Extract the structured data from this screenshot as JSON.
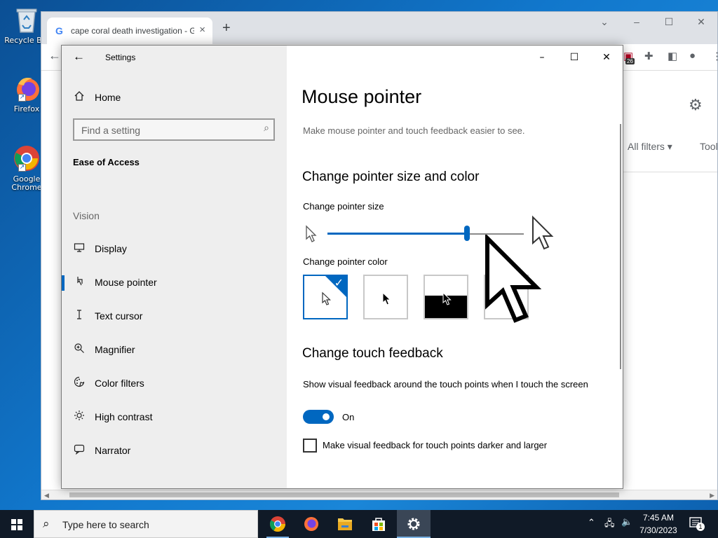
{
  "desktop": {
    "icons": [
      {
        "label": "Recycle Bin",
        "icon": "recycle-bin-icon"
      },
      {
        "label": "Firefox",
        "icon": "firefox-icon"
      },
      {
        "label": "Google Chrome",
        "icon": "chrome-icon"
      }
    ]
  },
  "browser": {
    "tab_title": "cape coral death investigation - Google Search",
    "new_tab": "+",
    "filters_label": "All filters ▾",
    "tools_label": "Tools",
    "extension_badge": "26"
  },
  "settings": {
    "app_title": "Settings",
    "sidebar": {
      "home_label": "Home",
      "search_placeholder": "Find a setting",
      "section_title": "Ease of Access",
      "group_label": "Vision",
      "items": [
        {
          "label": "Display",
          "icon": "display-icon"
        },
        {
          "label": "Mouse pointer",
          "icon": "mouse-pointer-icon",
          "selected": true
        },
        {
          "label": "Text cursor",
          "icon": "text-cursor-icon"
        },
        {
          "label": "Magnifier",
          "icon": "magnifier-icon"
        },
        {
          "label": "Color filters",
          "icon": "color-filters-icon"
        },
        {
          "label": "High contrast",
          "icon": "high-contrast-icon"
        },
        {
          "label": "Narrator",
          "icon": "narrator-icon"
        }
      ]
    },
    "content": {
      "title": "Mouse pointer",
      "description": "Make mouse pointer and touch feedback easier to see.",
      "pointer_section": "Change pointer size and color",
      "size_label": "Change pointer size",
      "size_value_fraction": 0.71,
      "color_label": "Change pointer color",
      "color_options": [
        "white",
        "black",
        "inverted",
        "custom"
      ],
      "color_selected": "white",
      "touch_section": "Change touch feedback",
      "touch_desc": "Show visual feedback around the touch points when I touch the screen",
      "toggle_state": "On",
      "checkbox_label": "Make visual feedback for touch points darker and larger",
      "checkbox_checked": false
    }
  },
  "taskbar": {
    "search_placeholder": "Type here to search",
    "apps": [
      "chrome-icon",
      "firefox-icon",
      "file-explorer-icon",
      "store-icon",
      "settings-icon"
    ],
    "time": "7:45 AM",
    "date": "7/30/2023",
    "notification_count": "1"
  },
  "colors": {
    "accent": "#0067c0",
    "sidebar_bg": "#eeeeee",
    "taskbar_bg": "#101a27"
  }
}
